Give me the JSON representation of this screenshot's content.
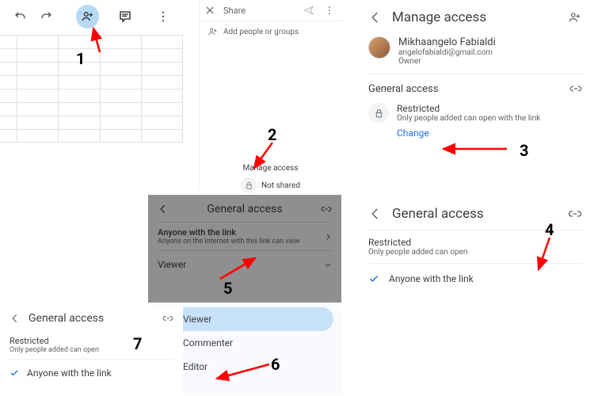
{
  "annotations": {
    "n1": "1",
    "n2": "2",
    "n3": "3",
    "n4": "4",
    "n5": "5",
    "n6": "6",
    "n7": "7"
  },
  "p2": {
    "share_title": "Share",
    "add_placeholder": "Add people or groups",
    "manage_title": "Manage access",
    "status": "Not shared"
  },
  "p3": {
    "title": "Manage access",
    "owner_name": "Mikhaangelo Fabialdi",
    "owner_email": "angelofabialdi@gmail.com",
    "owner_role": "Owner",
    "section": "General access",
    "restricted_title": "Restricted",
    "restricted_sub": "Only people added can open with the link",
    "change": "Change"
  },
  "p4": {
    "title": "General access",
    "restricted_title": "Restricted",
    "restricted_sub": "Only people added can open",
    "anyone": "Anyone with the link"
  },
  "p5": {
    "title": "General access",
    "anyone_title": "Anyone with the link",
    "anyone_sub": "Anyone on the Internet with this link can view",
    "role": "Viewer"
  },
  "p6": {
    "roles": {
      "viewer": "Viewer",
      "commenter": "Commenter",
      "editor": "Editor"
    }
  },
  "p7": {
    "title": "General access",
    "restricted_title": "Restricted",
    "restricted_sub": "Only people added can open",
    "anyone": "Anyone with the link"
  }
}
